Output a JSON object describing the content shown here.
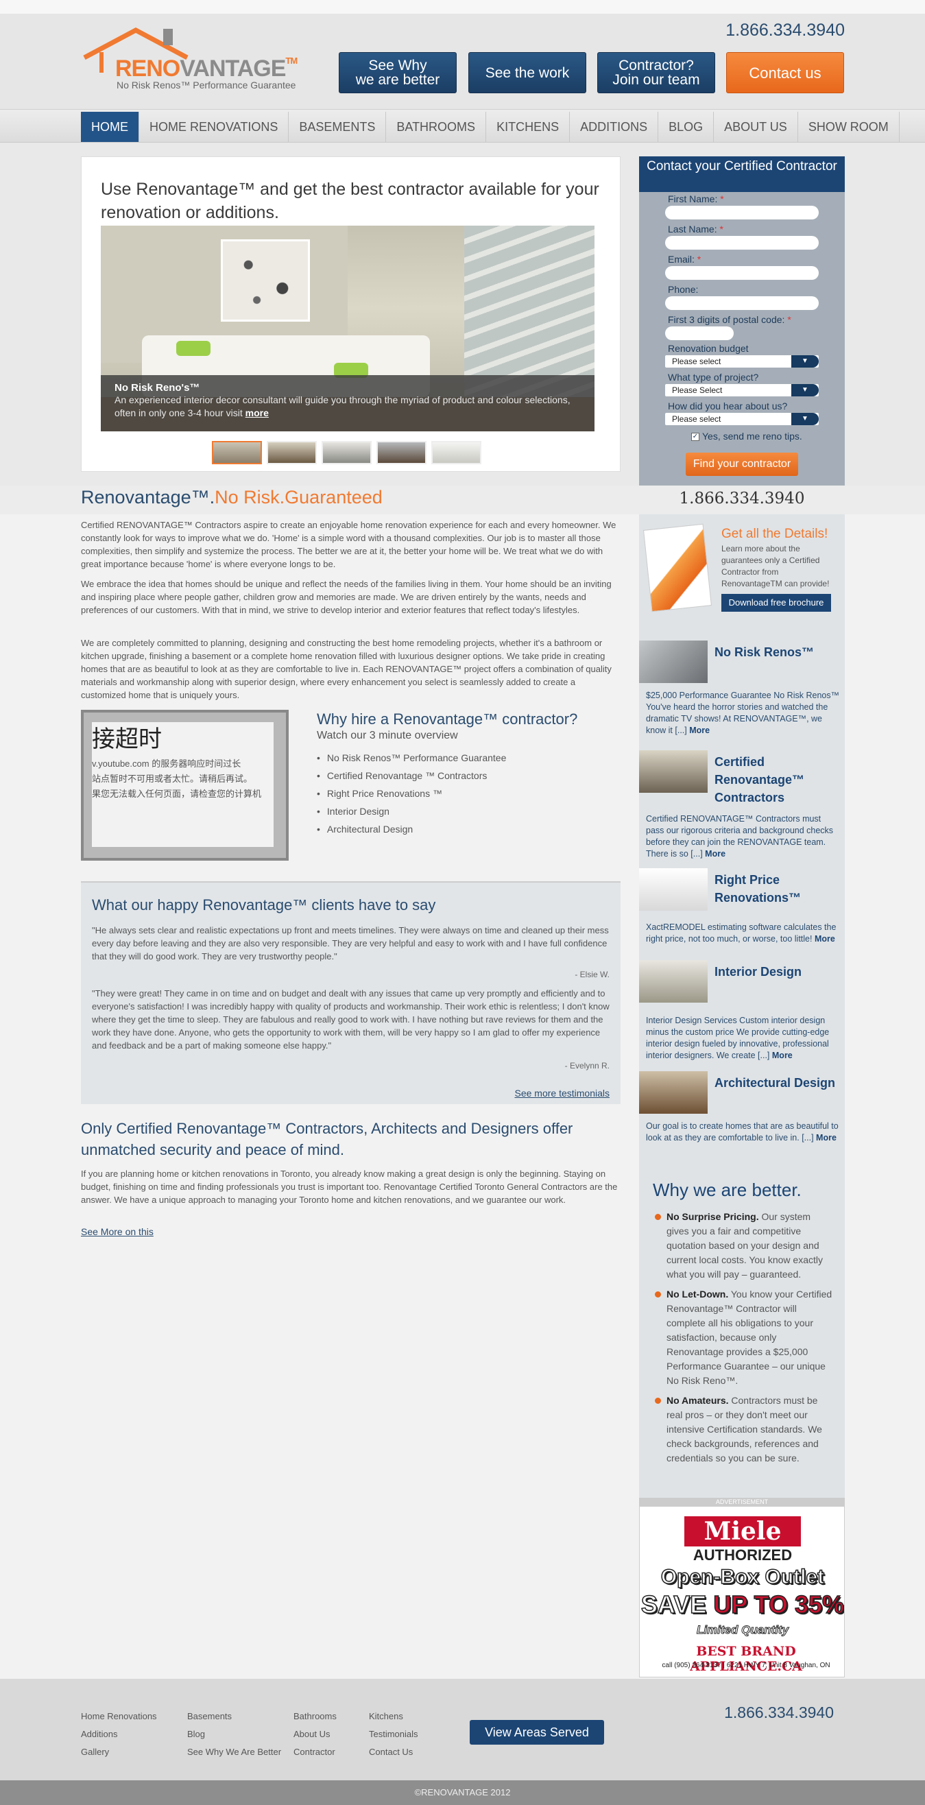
{
  "header": {
    "phone": "1.866.334.3940",
    "logo_reno": "RENO",
    "logo_vantage": "VANTAGE",
    "logo_tm": "TM",
    "logo_tagline": "No Risk Renos™ Performance Guarantee",
    "buttons": [
      {
        "line1": "See Why",
        "line2": "we are better"
      },
      {
        "line1": "See the work",
        "line2": ""
      },
      {
        "line1": "Contractor?",
        "line2": "Join our team"
      },
      {
        "line1": "Contact us",
        "line2": ""
      }
    ]
  },
  "nav": {
    "items": [
      "HOME",
      "HOME RENOVATIONS",
      "BASEMENTS",
      "BATHROOMS",
      "KITCHENS",
      "ADDITIONS",
      "BLOG",
      "ABOUT US",
      "SHOW ROOM"
    ],
    "active": "HOME"
  },
  "hero": {
    "title": "Use Renovantage™ and get the best contractor available for your renovation or additions.",
    "caption_title": "No Risk Reno's™",
    "caption_text": "An experienced interior decor consultant will guide you through the myriad of product and colour selections, often in only one 3-4 hour visit",
    "caption_more": "more",
    "thumbnail_count": 5
  },
  "form": {
    "title": "Contact your Certified Contractor",
    "fields": [
      {
        "label": "First Name:",
        "required": "*"
      },
      {
        "label": "Last Name:",
        "required": "*"
      },
      {
        "label": "Email:",
        "required": "*"
      },
      {
        "label": "Phone:",
        "required": ""
      },
      {
        "label": "First 3 digits of postal code:",
        "required": "*"
      }
    ],
    "selects": [
      {
        "label": "Renovation budget",
        "value": "Please select"
      },
      {
        "label": "What type of project?",
        "value": "Please Select"
      },
      {
        "label": "How did you hear about us?",
        "value": "Please select"
      }
    ],
    "checkbox_label": "Yes, send me reno tips.",
    "submit": "Find your contractor"
  },
  "side_phone": "1.866.334.3940",
  "intro": {
    "title_main": "Renovantage™.",
    "title_accent": "No Risk.Guaranteed",
    "p1": "Certified RENOVANTAGE™ Contractors aspire to create an enjoyable home renovation experience for each and every homeowner. We constantly look for ways to improve what we do. 'Home' is a simple word with a thousand complexities. Our job is to master all those complexities, then simplify and systemize the process. The better we are at it, the better your home will be. We treat what we do with great importance because 'home' is where everyone longs to be.",
    "p2": "We embrace the idea that homes should be unique and reflect the needs of the families living in them. Your home should be an inviting and inspiring place where people gather, children grow and memories are made. We are driven entirely by the wants, needs and preferences of our customers. With that in mind, we strive to develop interior and exterior features that reflect today's lifestyles.",
    "p3": "We are completely committed to planning, designing and constructing the best home remodeling projects, whether it's a bathroom or kitchen upgrade, finishing a basement or a complete home renovation filled with luxurious designer options. We take pride in creating homes that are as beautiful to look at as they are comfortable to live in. Each RENOVANTAGE™ project offers a combination of quality materials and workmanship along with superior design, where every enhancement you select is seamlessly added to create a customized home that is uniquely yours."
  },
  "video": {
    "line1": "接超时",
    "line2": "v.youtube.com 的服务器响应时间过长",
    "line3": "站点暂时不可用或者太忙。请稍后再试。",
    "line4": "果您无法载入任何页面，请检查您的计算机"
  },
  "why_hire": {
    "title": "Why hire a Renovantage™ contractor?",
    "subtitle": "Watch our 3 minute overview",
    "items": [
      "No Risk Renos™ Performance Guarantee",
      "Certified Renovantage ™ Contractors",
      "Right Price Renovations ™",
      "Interior Design",
      "Architectural Design"
    ]
  },
  "testimonials": {
    "title": "What our happy Renovantage™ clients have to say",
    "q1": "\"He always sets clear and realistic expectations up front and meets timelines. They were always on time and cleaned up their mess every day before leaving and they are also very responsible. They are very helpful and easy to work with and I have full confidence that they will do good work. They are very trustworthy people.\"",
    "a1": "- Elsie W.",
    "q2": "\"They were great! They came in on time and on budget and dealt with any issues that came up very promptly and efficiently and to everyone's satisfaction! I was incredibly happy with quality of products and workmanship. Their work ethic is relentless; I don't know where they get the time to sleep. They are fabulous and really good to work with. I have nothing but rave reviews for them and the work they have done. Anyone, who gets the opportunity to work with them, will be very happy so I am glad to offer my experience and feedback and be a part of making someone else happy.\"",
    "a2": "- Evelynn R.",
    "more": "See more testimonials"
  },
  "certified": {
    "title": "Only Certified Renovantage™ Contractors, Architects and Designers offer unmatched security and peace of mind.",
    "text": "If you are planning home or kitchen renovations in Toronto, you already know making a great design is only the beginning. Staying on budget, finishing on time and finding professionals you trust is important too. Renovantage Certified Toronto General Contractors are the answer. We have a unique approach to managing your Toronto home and kitchen renovations, and we guarantee our work.",
    "link": "See More on this"
  },
  "brochure": {
    "title": "Get all the Details!",
    "text": "Learn more about the guarantees only a Certified Contractor from RenovantageTM can provide!",
    "button": "Download free brochure"
  },
  "features": [
    {
      "title": "No Risk Renos™",
      "text": "$25,000 Performance Guarantee   No Risk Renos™ You've heard the horror stories and watched the dramatic TV shows! At RENOVANTAGE™, we know it [...]",
      "more": "More"
    },
    {
      "title": "Certified Renovantage™ Contractors",
      "text": "Certified RENOVANTAGE™ Contractors must pass our rigorous criteria and background checks before they can join the RENOVANTAGE team. There is so [...]",
      "more": "More"
    },
    {
      "title": "Right Price Renovations™",
      "text": "XactREMODEL estimating software calculates the right price, not too much, or worse, too little!",
      "more": "More"
    },
    {
      "title": "Interior Design",
      "text": "Interior Design Services Custom interior design minus the custom price We provide cutting-edge interior design fueled by innovative, professional interior designers. We create [...]",
      "more": "More"
    },
    {
      "title": "Architectural Design",
      "text": "Our goal is to create homes that are as beautiful to look at as they are comfortable to live in. [...]",
      "more": "More"
    }
  ],
  "better": {
    "title": "Why we are better.",
    "items": [
      {
        "bold": "No Surprise Pricing.",
        "text": " Our system gives you a fair and competitive quotation based on your design and current local costs. You know exactly what you will pay – guaranteed."
      },
      {
        "bold": "No Let-Down.",
        "text": " You know your Certified Renovantage™ Contractor will complete all his obligations to your satisfaction, because only Renovantage provides a $25,000 Performance Guarantee – our unique No Risk Reno™."
      },
      {
        "bold": "No Amateurs.",
        "text": " Contractors must be real pros – or they don't meet our intensive Certification standards. We check backgrounds, references and credentials so you can be sure."
      }
    ]
  },
  "ad": {
    "label": "ADVERTISEMENT",
    "brand": "Miele",
    "line1": "AUTHORIZED",
    "line2": "Open-Box Outlet",
    "line3a": "SAVE",
    "line3b": "UP TO 35%",
    "line4": "Limited Quantity",
    "line5": "BEST BRAND APPLIANCE.CA",
    "line6": "call (905) 264-3137  |  6221 HWY 7, Unit 8 Vaughan, ON"
  },
  "footer": {
    "col1": [
      "Home Renovations",
      "Additions",
      "Gallery"
    ],
    "col2": [
      "Basements",
      "Blog",
      "See Why We Are Better"
    ],
    "col3": [
      "Bathrooms",
      "About Us",
      "Contractor"
    ],
    "col4": [
      "Kitchens",
      "Testimonials",
      "Contact Us"
    ],
    "areas_button": "View Areas Served",
    "phone": "1.866.334.3940",
    "copyright": "©RENOVANTAGE 2012"
  },
  "colors": {
    "brand_orange": "#f07a31",
    "brand_blue": "#1c4574",
    "nav_active": "#235489"
  }
}
